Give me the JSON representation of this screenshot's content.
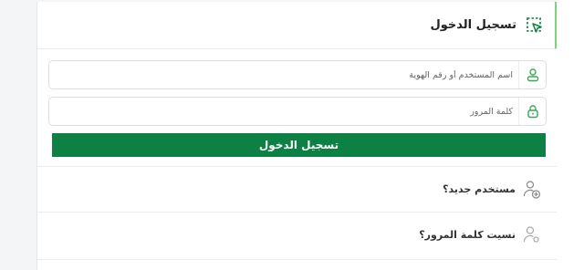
{
  "header": {
    "title": "تسجيل الدخول",
    "icon": "cursor-select-icon"
  },
  "form": {
    "username_placeholder": "اسم المستخدم أو رقم الهوية",
    "password_placeholder": "كلمة المرور",
    "submit_label": "تسجيل الدخول"
  },
  "links": {
    "new_user": "مستخدم جديد؟",
    "forgot_password": "نسيت كلمة المرور؟"
  },
  "colors": {
    "accent": "#0d8043",
    "icon_green": "#3aa657",
    "header_border": "#7fd17b"
  }
}
